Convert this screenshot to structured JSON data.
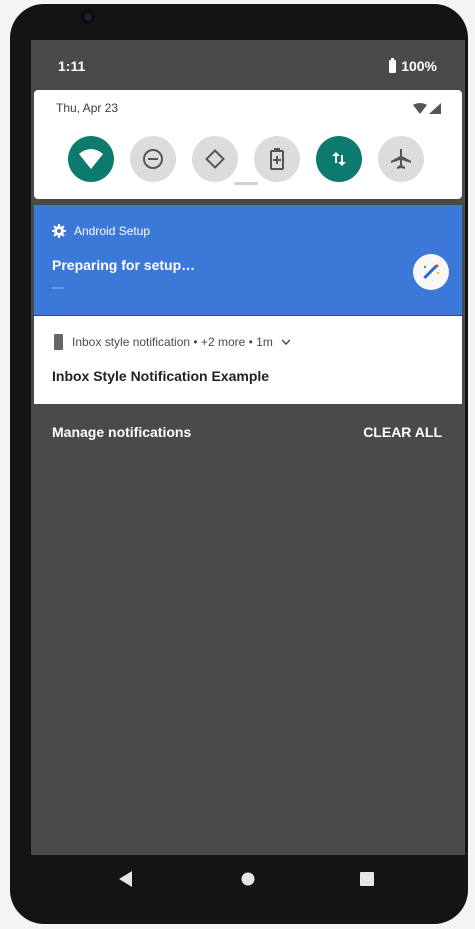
{
  "status_bar": {
    "time": "1:11",
    "battery_percent": "100%"
  },
  "quick_settings": {
    "date": "Thu, Apr 23",
    "tiles": [
      {
        "name": "wifi",
        "icon": "wifi-icon",
        "active": true
      },
      {
        "name": "do-not-disturb",
        "icon": "do-not-disturb-icon",
        "active": false
      },
      {
        "name": "auto-rotate",
        "icon": "auto-rotate-icon",
        "active": false
      },
      {
        "name": "battery-saver",
        "icon": "battery-saver-icon",
        "active": false
      },
      {
        "name": "mobile-data",
        "icon": "mobile-data-icon",
        "active": true
      },
      {
        "name": "airplane-mode",
        "icon": "airplane-icon",
        "active": false
      }
    ]
  },
  "notifications": {
    "setup": {
      "app_name": "Android Setup",
      "title": "Preparing for setup…",
      "icon": "gear-icon",
      "action_icon": "magic-wand-icon"
    },
    "inbox": {
      "header": "Inbox style notification • +2 more • 1m",
      "title": "Inbox Style Notification Example",
      "icon": "phone-icon"
    }
  },
  "footer": {
    "manage_label": "Manage notifications",
    "clear_all_label": "CLEAR ALL"
  },
  "colors": {
    "accent": "#0d7a6e",
    "setup_background": "#3c78d8",
    "shade_background": "#4a4a4a"
  }
}
